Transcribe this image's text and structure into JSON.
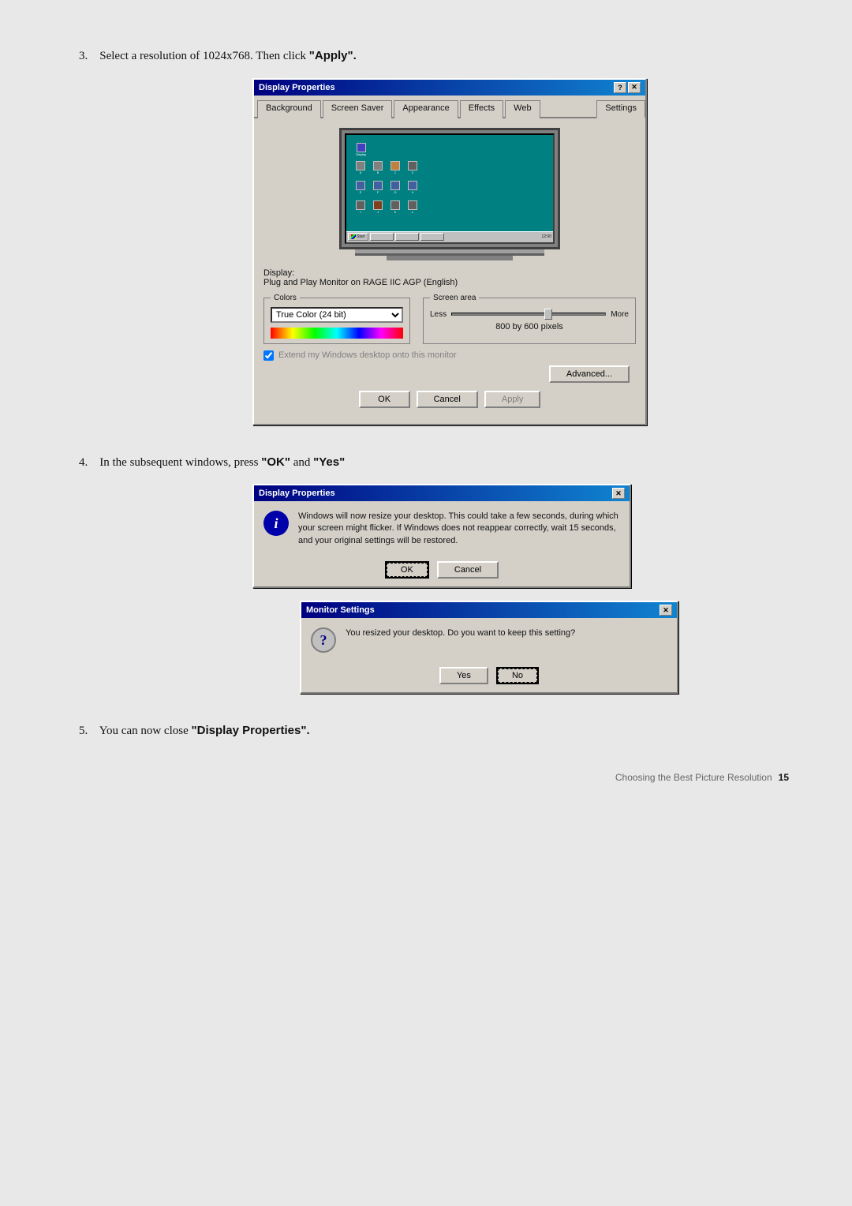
{
  "steps": [
    {
      "number": "3.",
      "text": "Select a resolution of 1024x768. Then click ",
      "bold": "\"Apply\"."
    },
    {
      "number": "4.",
      "text": "In the subsequent windows, press ",
      "bold1": "\"OK\"",
      "and": " and ",
      "bold2": "\"Yes\""
    },
    {
      "number": "5.",
      "text": "You can now close ",
      "bold": "\"Display Properties\"."
    }
  ],
  "display_properties": {
    "title": "Display Properties",
    "tabs": [
      "Background",
      "Screen Saver",
      "Appearance",
      "Effects",
      "Web",
      "Settings"
    ],
    "active_tab": "Settings",
    "display_label": "Display:",
    "display_name": "Plug and Play Monitor on RAGE IIC AGP (English)",
    "colors_label": "Colors",
    "colors_value": "True Color (24 bit)",
    "screen_area_label": "Screen area",
    "less_label": "Less",
    "more_label": "More",
    "pixels_text": "800 by 600 pixels",
    "checkbox_label": "Extend my Windows desktop onto this monitor",
    "advanced_btn": "Advanced...",
    "ok_btn": "OK",
    "cancel_btn": "Cancel",
    "apply_btn": "Apply"
  },
  "resize_dialog": {
    "title": "Display Properties",
    "message": "Windows will now resize your desktop. This could take a few seconds, during which your screen might flicker. If Windows does not reappear correctly, wait 15 seconds, and your original settings will be restored.",
    "ok_btn": "OK",
    "cancel_btn": "Cancel"
  },
  "monitor_dialog": {
    "title": "Monitor Settings",
    "message": "You resized your desktop.  Do you want to keep this setting?",
    "yes_btn": "Yes",
    "no_btn": "No"
  },
  "footer": {
    "text": "Choosing the Best Picture Resolution",
    "page": "15"
  }
}
